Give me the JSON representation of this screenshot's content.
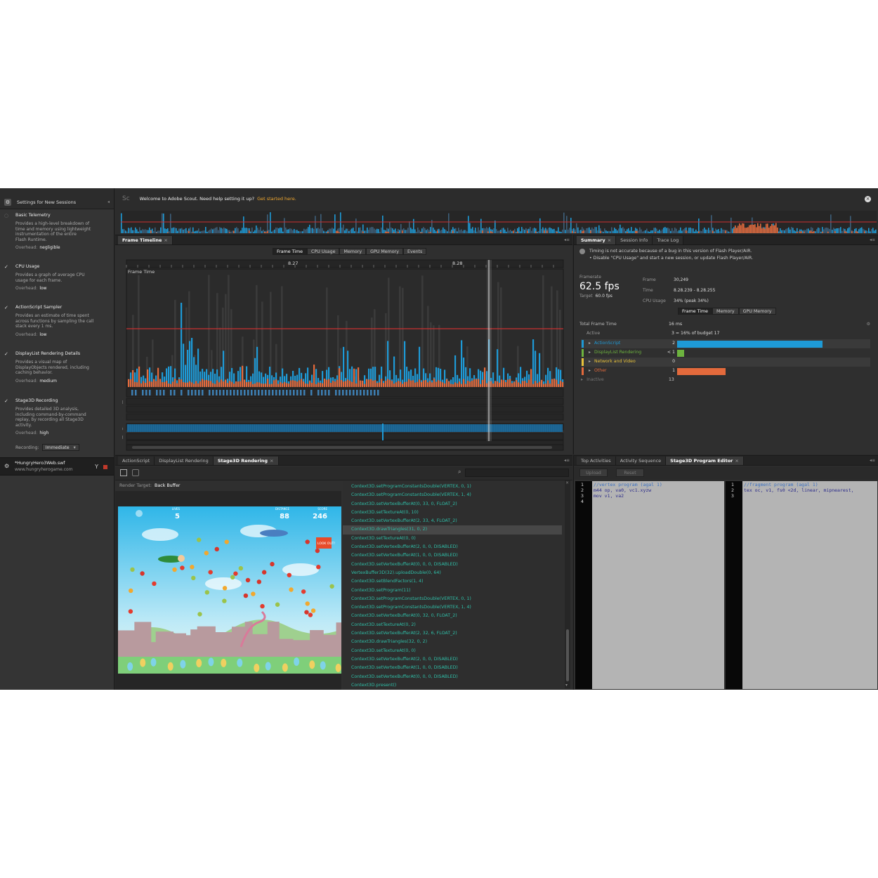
{
  "colors": {
    "actionscript": "#1e9ad6",
    "displaylist": "#6db33f",
    "network": "#e8c23a",
    "other": "#e36a3c",
    "budget_line": "#c93030",
    "accent_link": "#f0a830"
  },
  "sidebar": {
    "title": "Settings for New Sessions",
    "settings": [
      {
        "name": "Basic Telemetry",
        "desc": [
          "Provides a high-level breakdown of",
          "time and memory using lightweight",
          "instrumentation of the entire",
          "Flash Runtime."
        ],
        "overhead_label": "Overhead:",
        "overhead": "negligible",
        "checked": false
      },
      {
        "name": "CPU Usage",
        "desc": [
          "Provides a graph of average CPU",
          "usage for each frame."
        ],
        "overhead_label": "Overhead:",
        "overhead": "low",
        "checked": true
      },
      {
        "name": "ActionScript Sampler",
        "desc": [
          "Provides an estimate of time spent",
          "across functions by sampling the call",
          "stack every 1 ms."
        ],
        "overhead_label": "Overhead:",
        "overhead": "low",
        "checked": true
      },
      {
        "name": "DisplayList Rendering Details",
        "desc": [
          "Provides a visual map of",
          "DisplayObjects rendered, including",
          "caching behavior."
        ],
        "overhead_label": "Overhead:",
        "overhead": "medium",
        "checked": true
      },
      {
        "name": "Stage3D Recording",
        "desc": [
          "Provides detailed 3D analysis,",
          "including command-by-command",
          "replay, by recording all Stage3D",
          "activity."
        ],
        "overhead_label": "Overhead:",
        "overhead": "high",
        "checked": true
      }
    ],
    "recording_label": "Recording:",
    "recording_value": "Immediate",
    "session": {
      "file": "*HungryHero3Web.swf",
      "url": "www.hungryherogame.com"
    }
  },
  "banner": {
    "logo": "Sc",
    "text": "Welcome to Adobe Scout. Need help setting it up?",
    "link": "Get started here."
  },
  "frame_timeline": {
    "tab": "Frame Timeline",
    "toggles": [
      "Frame Time",
      "CPU Usage",
      "Memory",
      "GPU Memory",
      "Events"
    ],
    "time_marks": [
      "8.27",
      "8.28"
    ],
    "chart_label": "Frame Time"
  },
  "summary": {
    "tabs": [
      "Summary",
      "Session Info",
      "Trace Log"
    ],
    "warning": [
      "Timing is not accurate because of a bug in this version of Flash Player/AIR.",
      "• Disable \"CPU Usage\" and start a new session, or update Flash Player/AIR."
    ],
    "framerate_label": "Framerate",
    "framerate": "62.5 fps",
    "target_label": "Target",
    "target": "60.0 fps",
    "frame_label": "Frame",
    "frame": "30,249",
    "time_label": "Time",
    "time": "8.28.239 - 8.28.255",
    "cpu_label": "CPU Usage",
    "cpu": "34% (peak 34%)",
    "toggles": [
      "Frame Time",
      "Memory",
      "GPU Memory"
    ],
    "total_label": "Total Frame Time",
    "total": "16 ms",
    "active_label": "Active",
    "active": "3 = 16% of budget 17",
    "rows": [
      {
        "label": "ActionScript",
        "value": "2",
        "fraction": 0.6,
        "color": "#1e9ad6"
      },
      {
        "label": "DisplayList Rendering",
        "value": "< 1",
        "fraction": 0.03,
        "color": "#6db33f"
      },
      {
        "label": "Network and Video",
        "value": "0",
        "fraction": 0,
        "color": "#e8c23a"
      },
      {
        "label": "Other",
        "value": "1",
        "fraction": 0.2,
        "color": "#e36a3c"
      }
    ],
    "inactive_label": "Inactive",
    "inactive": "13"
  },
  "stage3d": {
    "tabs": [
      "ActionScript",
      "DisplayList Rendering",
      "Stage3D Rendering"
    ],
    "render_target_label": "Render Target:",
    "render_target": "Back Buffer",
    "game": {
      "hud_left_label": "LIVES",
      "hud_left": "5",
      "hud_mid_label": "DISTANCE",
      "hud_mid": "88",
      "hud_right_label": "SCORE",
      "hud_right": "246",
      "sign": "LOOK OUT!"
    },
    "commands": [
      "Context3D.setProgramConstantsDouble(VERTEX, 0, 1)",
      "Context3D.setProgramConstantsDouble(VERTEX, 1, 4)",
      "Context3D.setVertexBufferAt(0, 33, 0, FLOAT_2)",
      "Context3D.setTextureAt(0, 10)",
      "Context3D.setVertexBufferAt(2, 33, 4, FLOAT_2)",
      "Context3D.drawTriangles(31, 0, 2)",
      "Context3D.setTextureAt(0, 0)",
      "Context3D.setVertexBufferAt(2, 0, 0, DISABLED)",
      "Context3D.setVertexBufferAt(1, 0, 0, DISABLED)",
      "Context3D.setVertexBufferAt(0, 0, 0, DISABLED)",
      "VertexBuffer3D(32).uploadDouble(0, 64)",
      "Context3D.setBlendFactors(1, 4)",
      "Context3D.setProgram(11)",
      "Context3D.setProgramConstantsDouble(VERTEX, 0, 1)",
      "Context3D.setProgramConstantsDouble(VERTEX, 1, 4)",
      "Context3D.setVertexBufferAt(0, 32, 0, FLOAT_2)",
      "Context3D.setTextureAt(0, 2)",
      "Context3D.setVertexBufferAt(2, 32, 6, FLOAT_2)",
      "Context3D.drawTriangles(32, 0, 2)",
      "Context3D.setTextureAt(0, 0)",
      "Context3D.setVertexBufferAt(2, 0, 0, DISABLED)",
      "Context3D.setVertexBufferAt(1, 0, 0, DISABLED)",
      "Context3D.setVertexBufferAt(0, 0, 0, DISABLED)",
      "Context3D.present()"
    ],
    "selected_index": 5
  },
  "program_editor": {
    "tabs": [
      "Top Activities",
      "Activity Sequence",
      "Stage3D Program Editor"
    ],
    "upload_label": "Upload",
    "reset_label": "Reset",
    "vertex_lines": [
      "//vertex program (agal 1)",
      "m44 op, va0, vc1.xyzw",
      "mov v1, va2",
      ""
    ],
    "vertex_line_nums": [
      "1",
      "2",
      "3",
      "4"
    ],
    "fragment_lines": [
      "//fragment program (agal 1)",
      "tex oc, v1, fs0 <2d, linear, mipnearest,",
      ""
    ],
    "fragment_line_nums": [
      "1",
      "2",
      "3"
    ]
  }
}
